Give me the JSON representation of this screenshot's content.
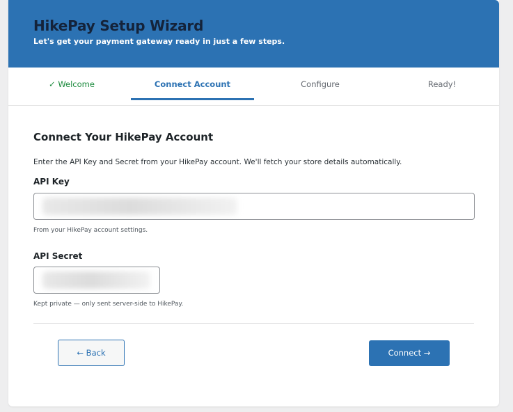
{
  "wizard": {
    "title": "HikePay Setup Wizard",
    "subtitle": "Let's get your payment gateway ready in just a few steps."
  },
  "steps": [
    {
      "label": "✓ Welcome",
      "state": "done"
    },
    {
      "label": "Connect Account",
      "state": "active"
    },
    {
      "label": "Configure",
      "state": "pending"
    },
    {
      "label": "Ready!",
      "state": "pending"
    }
  ],
  "connect": {
    "title": "Connect Your HikePay Account",
    "intro": "Enter the API Key and Secret from your HikePay account. We'll fetch your store details automatically.",
    "api_key": {
      "label": "API Key",
      "value": "",
      "hint": "From your HikePay account settings."
    },
    "api_secret": {
      "label": "API Secret",
      "value": "",
      "hint": "Kept private — only sent server-side to HikePay."
    }
  },
  "actions": {
    "back_label": "← Back",
    "connect_label": "Connect →"
  },
  "colors": {
    "accent": "#2c72b3",
    "done": "#1b8a3d"
  }
}
